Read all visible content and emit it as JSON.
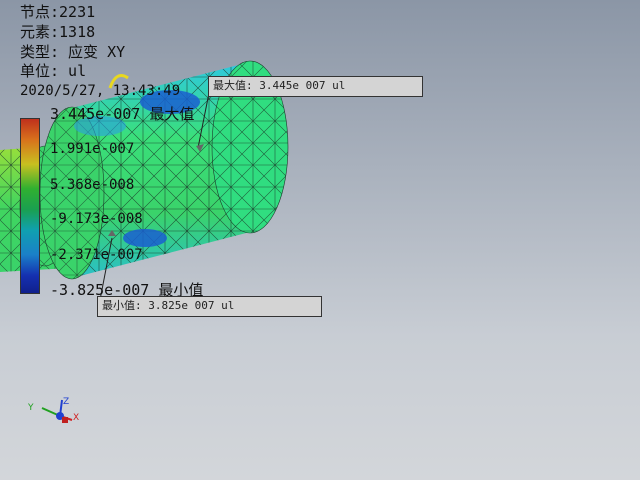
{
  "info": {
    "nodes": "节点:2231",
    "elements": "元素:1318",
    "type": "类型: 应变 XY",
    "unit": "单位: ul",
    "timestamp": "2020/5/27, 13:43:49"
  },
  "legend": {
    "max_value": "3.445e-007",
    "max_suffix": "最大值",
    "labels": [
      "1.991e-007",
      "5.368e-008",
      "-9.173e-008",
      "-2.371e-007"
    ],
    "min_value": "-3.825e-007",
    "min_suffix": "最小值"
  },
  "callouts": {
    "max": "最大值: 3.445e 007 ul",
    "min": "最小值:  3.825e 007 ul"
  },
  "triad": {
    "x": "X",
    "y": "Y",
    "z": "Z"
  },
  "colors": {
    "background_top": "#8b96a6",
    "background_bottom": "#d3d6da",
    "mesh_green": "#3ad36a",
    "mesh_cyan": "#3ac7d8"
  }
}
